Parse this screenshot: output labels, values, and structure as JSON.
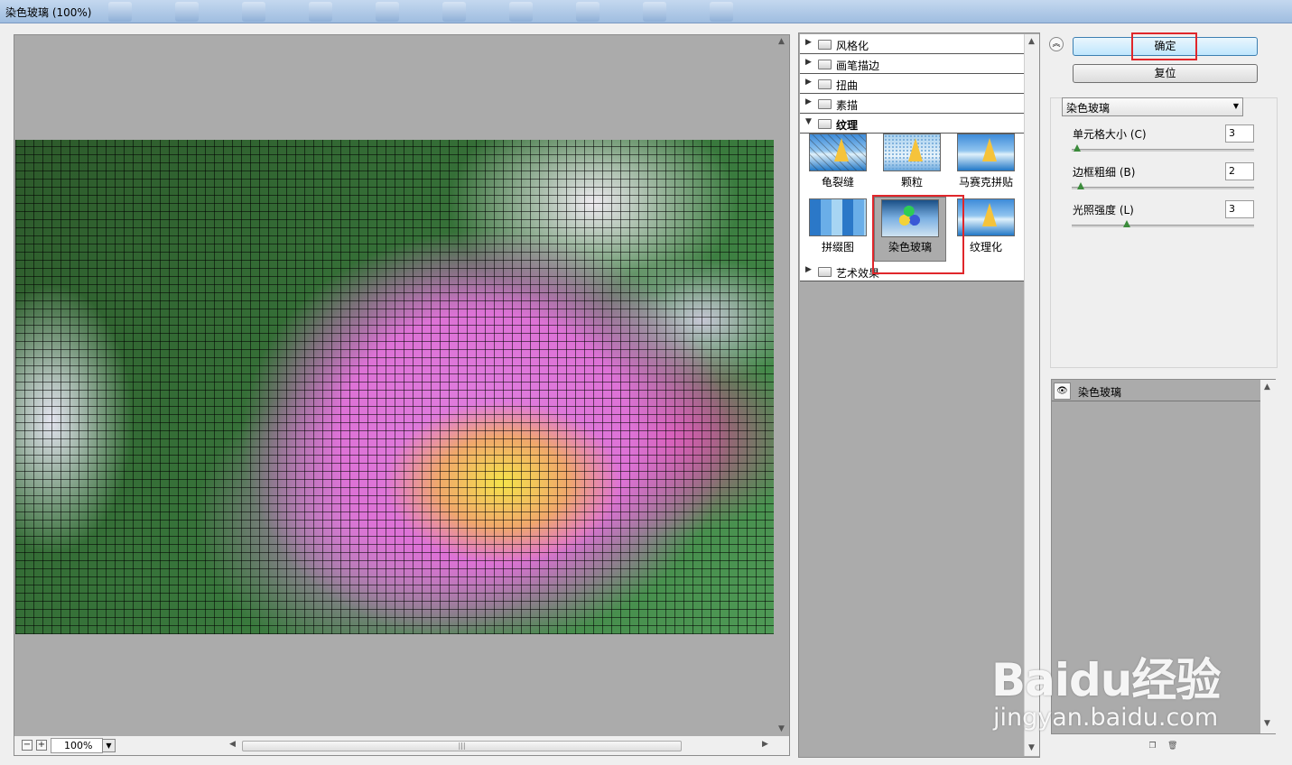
{
  "window": {
    "title": "染色玻璃 (100%)"
  },
  "preview": {
    "zoom_value": "100%",
    "zoom_minus": "−",
    "zoom_plus": "+",
    "zoom_drop": "▼"
  },
  "gallery": {
    "categories": [
      {
        "label": "风格化",
        "expanded": false
      },
      {
        "label": "画笔描边",
        "expanded": false
      },
      {
        "label": "扭曲",
        "expanded": false
      },
      {
        "label": "素描",
        "expanded": false
      },
      {
        "label": "纹理",
        "expanded": true
      },
      {
        "label": "艺术效果",
        "expanded": false
      }
    ],
    "texture_filters": [
      "龟裂缝",
      "颗粒",
      "马赛克拼贴",
      "拼缀图",
      "染色玻璃",
      "纹理化"
    ],
    "selected_filter": "染色玻璃"
  },
  "buttons": {
    "ok": "确定",
    "reset": "复位"
  },
  "settings": {
    "filter_select": "染色玻璃",
    "params": [
      {
        "label": "单元格大小 (C)",
        "value": "3",
        "level": 0.03
      },
      {
        "label": "边框粗细 (B)",
        "value": "2",
        "level": 0.05
      },
      {
        "label": "光照强度 (L)",
        "value": "3",
        "level": 0.3
      }
    ]
  },
  "effect_layers": [
    {
      "name": "染色玻璃",
      "visible": true
    }
  ],
  "watermark": {
    "brand": "Baidu经验",
    "site": "jingyan.baidu.com"
  },
  "colors": {
    "highlight": "#e0262b",
    "gallery_bg": "#ababab",
    "default_button": "#bee6fd"
  }
}
